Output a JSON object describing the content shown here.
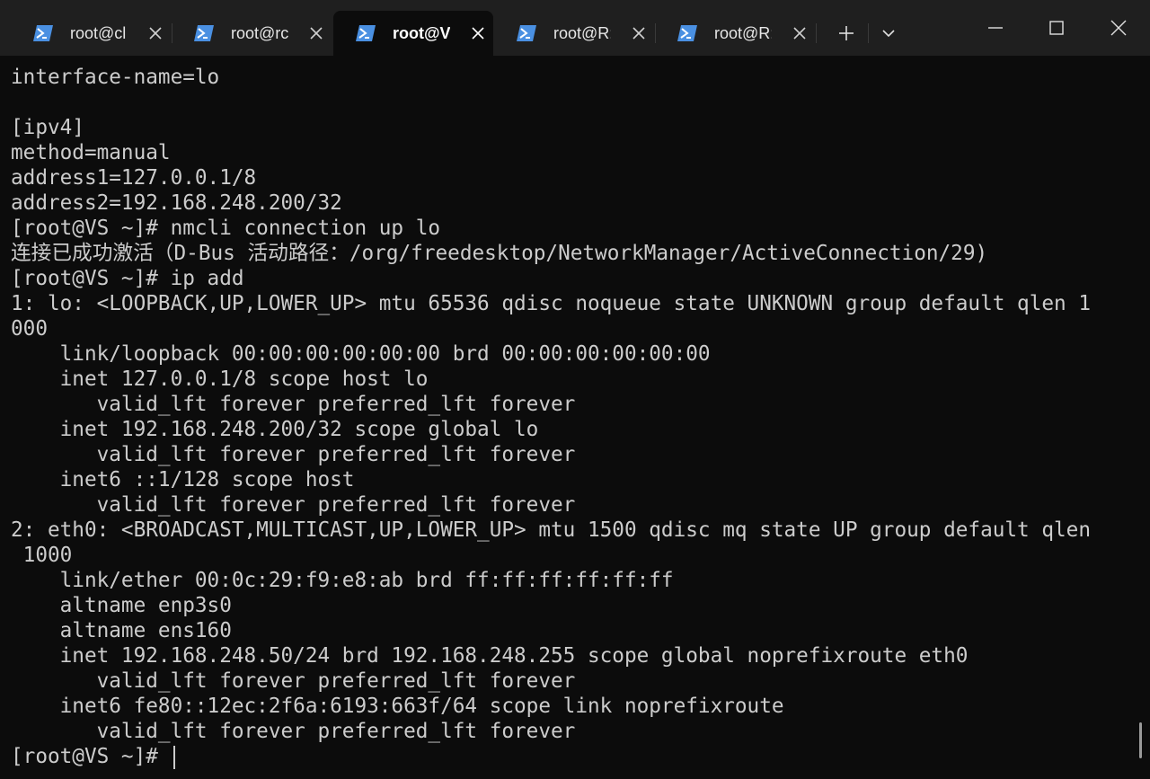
{
  "tabs": [
    {
      "label": "root@cl",
      "active": false
    },
    {
      "label": "root@rc",
      "active": false
    },
    {
      "label": "root@V:",
      "active": true
    },
    {
      "label": "root@R:",
      "active": false
    },
    {
      "label": "root@R:",
      "active": false
    }
  ],
  "icons": {
    "tab": "powershell-icon",
    "close": "close-icon",
    "new_tab": "plus-icon",
    "dropdown": "chevron-down-icon",
    "minimize": "minimize-icon",
    "maximize": "maximize-icon",
    "window_close": "window-close-icon"
  },
  "colors": {
    "terminal_bg": "#0c0c0c",
    "titlebar_bg": "#1f1f1f",
    "text": "#cccccc",
    "icon_blue": "#4a90e2"
  },
  "terminal": {
    "lines": [
      "interface-name=lo",
      "",
      "[ipv4]",
      "method=manual",
      "address1=127.0.0.1/8",
      "address2=192.168.248.200/32",
      "[root@VS ~]# nmcli connection up lo",
      "连接已成功激活（D-Bus 活动路径：/org/freedesktop/NetworkManager/ActiveConnection/29)",
      "[root@VS ~]# ip add",
      "1: lo: <LOOPBACK,UP,LOWER_UP> mtu 65536 qdisc noqueue state UNKNOWN group default qlen 1",
      "000",
      "    link/loopback 00:00:00:00:00:00 brd 00:00:00:00:00:00",
      "    inet 127.0.0.1/8 scope host lo",
      "       valid_lft forever preferred_lft forever",
      "    inet 192.168.248.200/32 scope global lo",
      "       valid_lft forever preferred_lft forever",
      "    inet6 ::1/128 scope host",
      "       valid_lft forever preferred_lft forever",
      "2: eth0: <BROADCAST,MULTICAST,UP,LOWER_UP> mtu 1500 qdisc mq state UP group default qlen",
      " 1000",
      "    link/ether 00:0c:29:f9:e8:ab brd ff:ff:ff:ff:ff:ff",
      "    altname enp3s0",
      "    altname ens160",
      "    inet 192.168.248.50/24 brd 192.168.248.255 scope global noprefixroute eth0",
      "       valid_lft forever preferred_lft forever",
      "    inet6 fe80::12ec:2f6a:6193:663f/64 scope link noprefixroute",
      "       valid_lft forever preferred_lft forever",
      "[root@VS ~]# "
    ]
  }
}
